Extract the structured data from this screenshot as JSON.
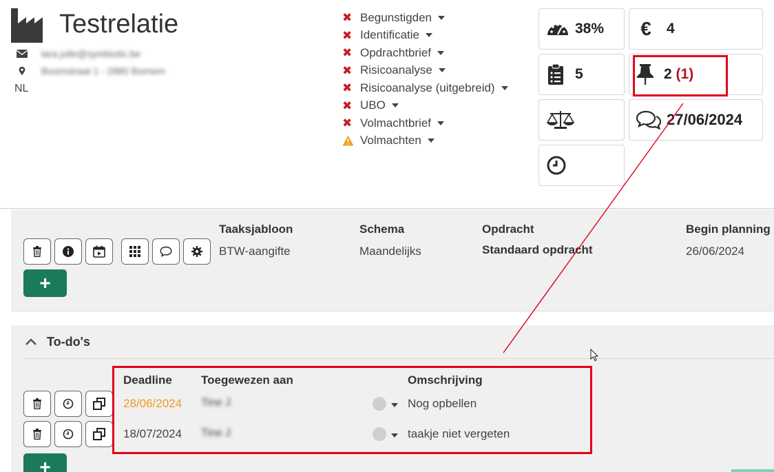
{
  "header": {
    "title": "Testrelatie",
    "email": "lara.jolle@symbiotic.be",
    "address": "Boomstraat 1 - 2880 Bornem",
    "country": "NL"
  },
  "statuses": [
    {
      "label": "Begunstigden",
      "state": "missing"
    },
    {
      "label": "Identificatie",
      "state": "missing"
    },
    {
      "label": "Opdrachtbrief",
      "state": "missing"
    },
    {
      "label": "Risicoanalyse",
      "state": "missing"
    },
    {
      "label": "Risicoanalyse (uitgebreid)",
      "state": "missing"
    },
    {
      "label": "UBO",
      "state": "missing"
    },
    {
      "label": "Volmachtbrief",
      "state": "missing"
    },
    {
      "label": "Volmachten",
      "state": "warning"
    }
  ],
  "tiles": {
    "progress": "38%",
    "euro": "4",
    "tasks": "5",
    "pins": "2",
    "pins_extra": "(1)",
    "date": "27/06/2024"
  },
  "task": {
    "headers": {
      "template": "Taaksjabloon",
      "schedule": "Schema",
      "assignment": "Opdracht",
      "begin": "Begin planning"
    },
    "template": "BTW-aangifte",
    "schedule": "Maandelijks",
    "assignment": "Standaard opdracht",
    "begin": "26/06/2024",
    "add_label": "+"
  },
  "todos": {
    "title": "To-do's",
    "headers": {
      "deadline": "Deadline",
      "assignee": "Toegewezen aan",
      "description": "Omschrijving"
    },
    "rows": [
      {
        "deadline": "28/06/2024",
        "assignee": "Tine J",
        "description": "Nog opbellen"
      },
      {
        "deadline": "18/07/2024",
        "assignee": "Tine J",
        "description": "taakje niet vergeten"
      }
    ],
    "add_label": "+"
  },
  "colors": {
    "accent_green": "#1b7a5a",
    "error_red": "#c81e1e",
    "warning": "#f0a020",
    "highlight": "#e0001b",
    "overdue": "#f09a22"
  }
}
